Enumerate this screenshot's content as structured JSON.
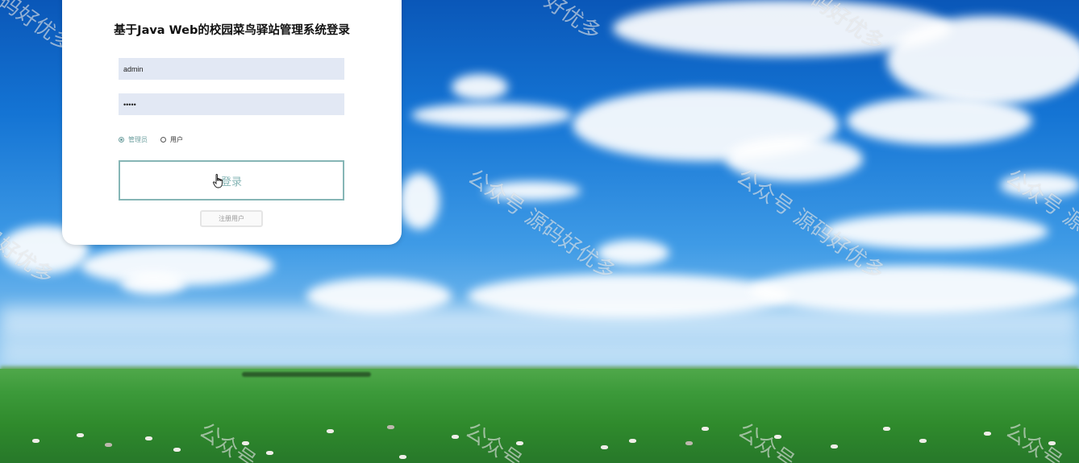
{
  "login": {
    "title": "基于Java Web的校园菜鸟驿站管理系统登录",
    "username_value": "admin",
    "password_value": "•••••",
    "roles": [
      {
        "label": "管理员",
        "selected": true
      },
      {
        "label": "用户",
        "selected": false
      }
    ],
    "login_label": "登录",
    "register_label": "注册用户"
  },
  "watermark": {
    "text": "公众号 源码好优多",
    "fragments": [
      "码好优多",
      "码好优多",
      "好优多",
      "好优多",
      "码好优多",
      "公众号",
      "公众号",
      "公众号",
      "公众号"
    ]
  },
  "colors": {
    "accent": "#86b6b6",
    "input_bg": "#e2e8f4"
  }
}
